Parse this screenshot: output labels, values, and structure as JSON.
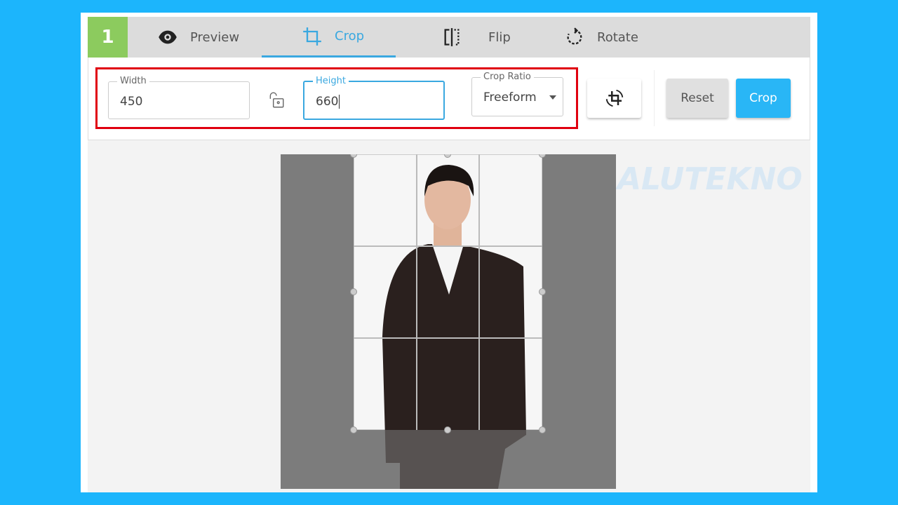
{
  "step": "1",
  "tabs": [
    {
      "label": "Preview",
      "icon": "eye-icon"
    },
    {
      "label": "Crop",
      "icon": "crop-icon",
      "active": true
    },
    {
      "label": "Flip",
      "icon": "flip-icon"
    },
    {
      "label": "Rotate",
      "icon": "rotate-icon"
    }
  ],
  "toolbar": {
    "width": {
      "label": "Width",
      "value": "450"
    },
    "height": {
      "label": "Height",
      "value": "660"
    },
    "ratio": {
      "label": "Crop Ratio",
      "value": "Freeform"
    },
    "reset_label": "Reset",
    "crop_label": "Crop"
  },
  "watermark": "ALUTEKNO",
  "colors": {
    "accent": "#3aa8e0",
    "crop_button": "#29b6f6",
    "highlight": "#e0000f",
    "badge": "#8ccb5e"
  }
}
